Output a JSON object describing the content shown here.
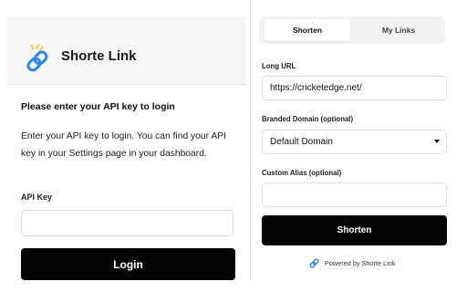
{
  "login": {
    "brand": "Shorte Link",
    "title": "Please enter your API key to login",
    "description": "Enter your API key to login. You can find your API key in your Settings page in your dashboard.",
    "api_label": "API Key",
    "api_value": "",
    "api_placeholder": "",
    "login_label": "Login"
  },
  "shorten": {
    "tabs": [
      {
        "label": "Shorten",
        "active": true
      },
      {
        "label": "My Links",
        "active": false
      }
    ],
    "long_url_label": "Long URL",
    "long_url_value": "https://cricketedge.net/",
    "domain_label": "Branded Domain (optional)",
    "domain_value": "Default Domain",
    "alias_label": "Custom Alias (optional)",
    "alias_value": "",
    "button_label": "Shorten",
    "powered_by": "Powered by Shorte Link"
  },
  "colors": {
    "button_bg": "#050505",
    "accent_blue": "#2f86e6",
    "accent_yellow": "#f2c94c"
  },
  "icons": {
    "brand": "chain-link-icon",
    "dropdown": "chevron-down-icon"
  }
}
